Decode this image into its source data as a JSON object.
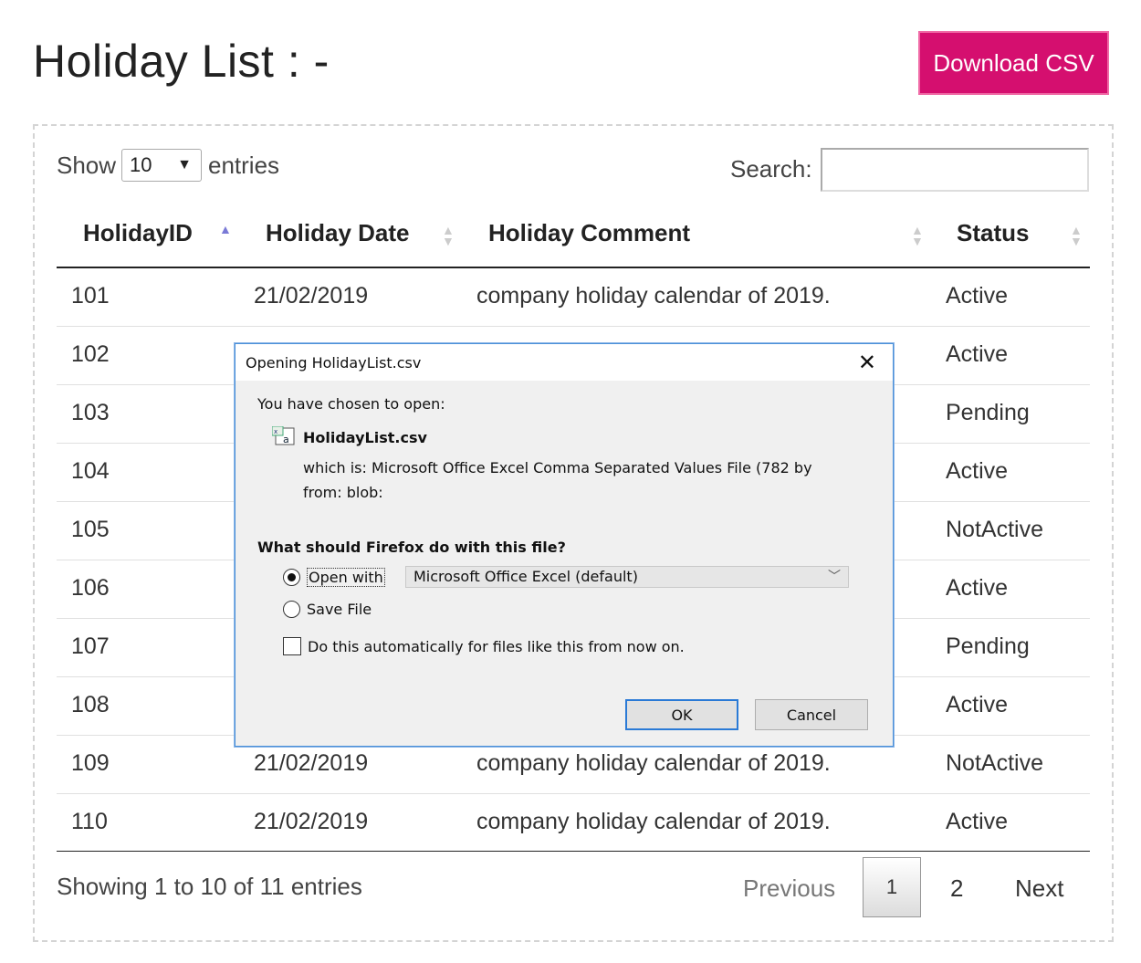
{
  "page": {
    "title": "Holiday List : -",
    "download_label": "Download CSV",
    "accent": "#d50f6f"
  },
  "controls": {
    "show_label": "Show",
    "page_size": "10",
    "entries_label": "entries",
    "search_label": "Search:",
    "search_value": ""
  },
  "table": {
    "headers": [
      "HolidayID",
      "Holiday Date",
      "Holiday Comment",
      "Status"
    ],
    "rows": [
      {
        "id": "101",
        "date": "21/02/2019",
        "comment": "company holiday calendar of 2019.",
        "status": "Active"
      },
      {
        "id": "102",
        "date": "",
        "comment": "",
        "status": "Active"
      },
      {
        "id": "103",
        "date": "",
        "comment": "",
        "status": "Pending"
      },
      {
        "id": "104",
        "date": "",
        "comment": "",
        "status": "Active"
      },
      {
        "id": "105",
        "date": "",
        "comment": "",
        "status": "NotActive"
      },
      {
        "id": "106",
        "date": "",
        "comment": "",
        "status": "Active"
      },
      {
        "id": "107",
        "date": "",
        "comment": "",
        "status": "Pending"
      },
      {
        "id": "108",
        "date": "",
        "comment": "",
        "status": "Active"
      },
      {
        "id": "109",
        "date": "21/02/2019",
        "comment": "company holiday calendar of 2019.",
        "status": "NotActive"
      },
      {
        "id": "110",
        "date": "21/02/2019",
        "comment": "company holiday calendar of 2019.",
        "status": "Active"
      }
    ]
  },
  "footer": {
    "info": "Showing 1 to 10 of 11 entries",
    "previous": "Previous",
    "current_page": "1",
    "page_2": "2",
    "next": "Next"
  },
  "dialog": {
    "title": "Opening HolidayList.csv",
    "chosen_to_open": "You have chosen to open:",
    "filename": "HolidayList.csv",
    "which_is": "which is:  Microsoft Office Excel Comma Separated Values File (782 by",
    "from": "from:  blob:",
    "question": "What should Firefox do with this file?",
    "open_with_label": "Open with",
    "open_with_app": "Microsoft Office Excel (default)",
    "save_file_label": "Save File",
    "auto_label": "Do this automatically for files like this from now on.",
    "ok_label": "OK",
    "cancel_label": "Cancel",
    "selected_option": "open_with"
  }
}
